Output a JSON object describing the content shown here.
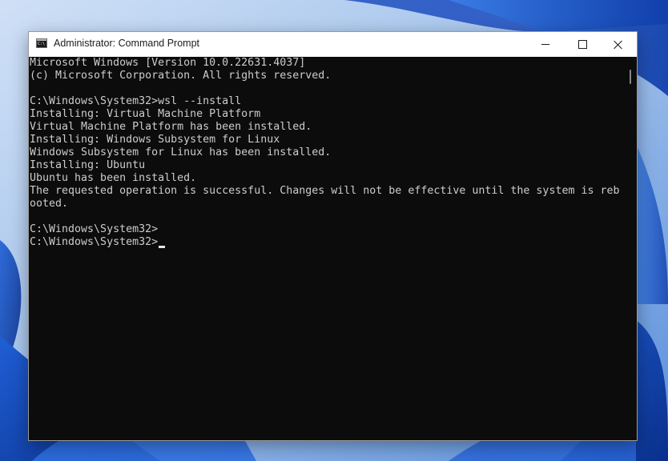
{
  "window": {
    "title": "Administrator: Command Prompt",
    "app_icon_text": "C:\\"
  },
  "console": {
    "lines": [
      "Microsoft Windows [Version 10.0.22631.4037]",
      "(c) Microsoft Corporation. All rights reserved.",
      "",
      "C:\\Windows\\System32>wsl --install",
      "Installing: Virtual Machine Platform",
      "Virtual Machine Platform has been installed.",
      "Installing: Windows Subsystem for Linux",
      "Windows Subsystem for Linux has been installed.",
      "Installing: Ubuntu",
      "Ubuntu has been installed.",
      "The requested operation is successful. Changes will not be effective until the system is reb",
      "ooted.",
      "",
      "C:\\Windows\\System32>",
      "C:\\Windows\\System32>"
    ]
  },
  "colors": {
    "console_background": "#0c0c0c",
    "console_text": "#cccccc",
    "titlebar_background": "#ffffff"
  },
  "icons": {
    "app": "cmd-icon",
    "minimize": "minimize-icon",
    "maximize": "maximize-icon",
    "close": "close-icon"
  }
}
